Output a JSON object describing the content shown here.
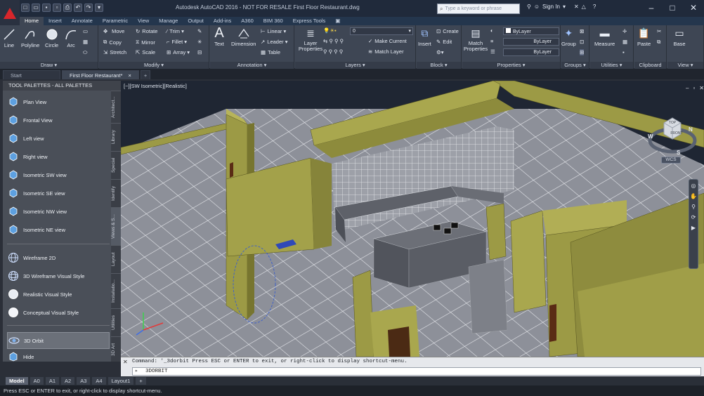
{
  "app": {
    "title": "Autodesk AutoCAD 2016 - NOT FOR RESALE    First Floor Restaurant.dwg"
  },
  "search": {
    "placeholder": "Type a keyword or phrase"
  },
  "account": {
    "signin": "Sign In"
  },
  "ribbon_tabs": [
    "Home",
    "Insert",
    "Annotate",
    "Parametric",
    "View",
    "Manage",
    "Output",
    "Add-ins",
    "A360",
    "BIM 360",
    "Express Tools"
  ],
  "ribbon": {
    "draw": {
      "title": "Draw ▾",
      "line": "Line",
      "polyline": "Polyline",
      "circle": "Circle",
      "arc": "Arc"
    },
    "modify": {
      "title": "Modify ▾",
      "move": "Move",
      "rotate": "Rotate",
      "trim": "Trim ▾",
      "copy": "Copy",
      "mirror": "Mirror",
      "fillet": "Fillet ▾",
      "stretch": "Stretch",
      "scale": "Scale",
      "array": "Array ▾"
    },
    "annotation": {
      "title": "Annotation ▾",
      "text": "Text",
      "dimension": "Dimension",
      "linear": "Linear ▾",
      "leader": "Leader ▾",
      "table": "Table"
    },
    "layers": {
      "title": "Layers ▾",
      "layer_properties": "Layer Properties",
      "current_layer": "0",
      "make_current": "Make Current",
      "match_layer": "Match Layer"
    },
    "block": {
      "title": "Block ▾",
      "insert": "Insert",
      "create": "Create",
      "edit": "Edit"
    },
    "properties": {
      "title": "Properties ▾",
      "match_properties": "Match Properties",
      "color": "ByLayer",
      "linetype": "ByLayer",
      "lineweight": "ByLayer"
    },
    "groups": {
      "title": "Groups ▾",
      "group": "Group"
    },
    "utilities": {
      "title": "Utilities ▾",
      "measure": "Measure"
    },
    "clipboard": {
      "title": "Clipboard",
      "paste": "Paste"
    },
    "view": {
      "title": "View ▾",
      "base": "Base"
    }
  },
  "doc_tabs": [
    "Start",
    "First Floor Restaurant*"
  ],
  "palette": {
    "title": "TOOL PALETTES - ALL PALETTES",
    "items": [
      "Plan View",
      "Frontal View",
      "Left view",
      "Right view",
      "Isometric SW view",
      "Isometric SE view",
      "Isometric NW view",
      "Isometric NE view",
      "Wireframe 2D",
      "3D Wireframe Visual Style",
      "Realistic Visual Style",
      "Conceptual Visual Style",
      "3D Orbit",
      "Hide"
    ],
    "side_tabs": [
      "Architect...",
      "Library",
      "Special",
      "Identify",
      "Views & S...",
      "Layout",
      "Installatio...",
      "Utilities",
      "3D Art"
    ]
  },
  "viewport": {
    "label": "[−][SW Isometric][Realistic]",
    "wcs": "WCS",
    "cube": {
      "top": "TOP",
      "front": "FRONT",
      "n": "N",
      "w": "W",
      "s": "S"
    }
  },
  "command": {
    "history": "Command: '_3dorbit Press ESC or ENTER to exit, or right-click to display shortcut-menu.",
    "input": "3DORBIT"
  },
  "layout_tabs": [
    "Model",
    "A0",
    "A1",
    "A2",
    "A3",
    "A4",
    "Layout1"
  ],
  "status": {
    "text": "Press ESC or ENTER to exit, or right-click to display shortcut-menu."
  },
  "colors": {
    "wall": "#9c9a45",
    "floor": "#8c9099",
    "accent": "#d8262b"
  }
}
